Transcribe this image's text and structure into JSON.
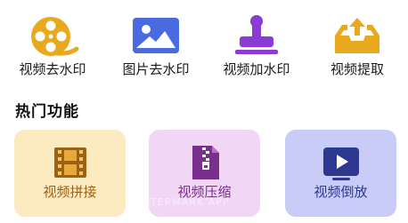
{
  "tools": [
    {
      "label": "视频去水印",
      "icon": "film-reel-icon",
      "color": "#E9A91E"
    },
    {
      "label": "图片去水印",
      "icon": "picture-icon",
      "color": "#4A6BE0"
    },
    {
      "label": "视频加水印",
      "icon": "stamp-icon",
      "color": "#8A3BD6"
    },
    {
      "label": "视频提取",
      "icon": "upload-tray-icon",
      "color": "#E9A91E"
    }
  ],
  "hot": {
    "title": "热门功能",
    "cards": [
      {
        "label": "视频拼接",
        "icon": "film-strip-icon",
        "bg": "#FCEBC0",
        "color": "#9A6212"
      },
      {
        "label": "视频压缩",
        "icon": "zip-file-icon",
        "bg": "#F1D6F6",
        "color": "#7A2E8E"
      },
      {
        "label": "视频倒放",
        "icon": "play-screen-icon",
        "bg": "#C9CCF7",
        "color": "#2D3890"
      }
    ]
  },
  "watermark": "WATERMARK APP"
}
